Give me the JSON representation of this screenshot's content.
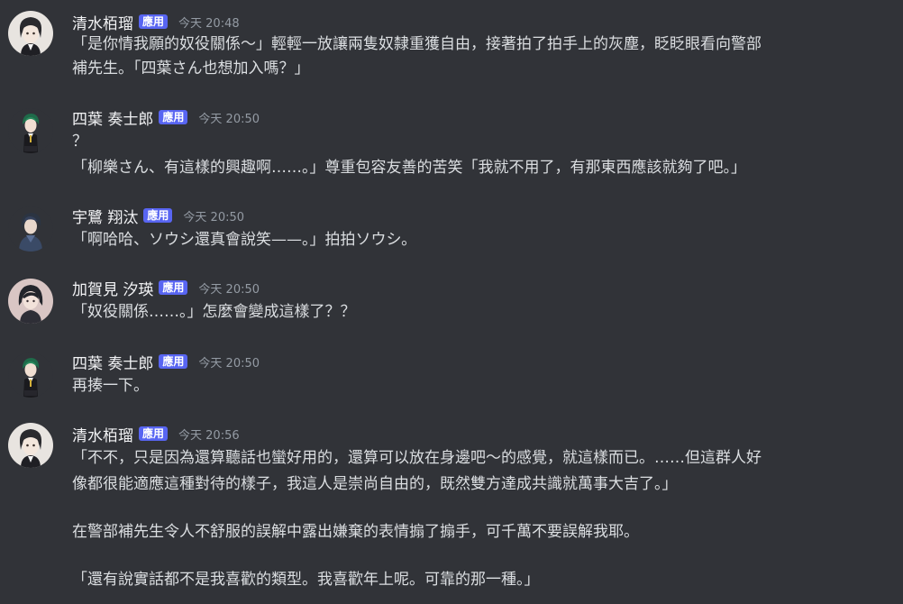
{
  "messages": [
    {
      "username": "清水栢瑠",
      "badge": "應用",
      "timestamp": "今天 20:48",
      "avatar": "avatar-kiyomizu",
      "lines": [
        "「是你情我願的奴役關係～」輕輕一放讓兩隻奴隸重獲自由，接著拍了拍手上的灰塵，眨眨眼看向警部",
        "補先生。「四葉さん也想加入嗎？」"
      ]
    },
    {
      "username": "四葉 奏士郎",
      "badge": "應用",
      "timestamp": "今天 20:50",
      "avatar": "avatar-yotsuba",
      "lines": [
        "？",
        "「柳樂さん、有這樣的興趣啊……。」尊重包容友善的苦笑「我就不用了，有那東西應該就夠了吧。」"
      ]
    },
    {
      "username": "宇鷺 翔汰",
      "badge": "應用",
      "timestamp": "今天 20:50",
      "avatar": "avatar-usagi",
      "lines": [
        "「啊哈哈、ソウシ還真會說笑——。」拍拍ソウシ。"
      ]
    },
    {
      "username": "加賀見 汐瑛",
      "badge": "應用",
      "timestamp": "今天 20:50",
      "avatar": "avatar-kagami",
      "lines": [
        "「奴役關係……。」怎麼會變成這樣了？？"
      ]
    },
    {
      "username": "四葉 奏士郎",
      "badge": "應用",
      "timestamp": "今天 20:50",
      "avatar": "avatar-yotsuba",
      "lines": [
        "再揍一下。"
      ]
    },
    {
      "username": "清水栢瑠",
      "badge": "應用",
      "timestamp": "今天 20:56",
      "avatar": "avatar-kiyomizu",
      "lines": [
        "「不不，只是因為還算聽話也蠻好用的，還算可以放在身邊吧～的感覺，就這樣而已。……但這群人好",
        "像都很能適應這種對待的樣子，我這人是崇尚自由的，既然雙方達成共識就萬事大吉了。」",
        "",
        "在警部補先生令人不舒服的誤解中露出嫌棄的表情搧了搧手，可千萬不要誤解我耶。",
        "",
        "「還有說實話都不是我喜歡的類型。我喜歡年上呢。可靠的那一種。」"
      ]
    }
  ]
}
